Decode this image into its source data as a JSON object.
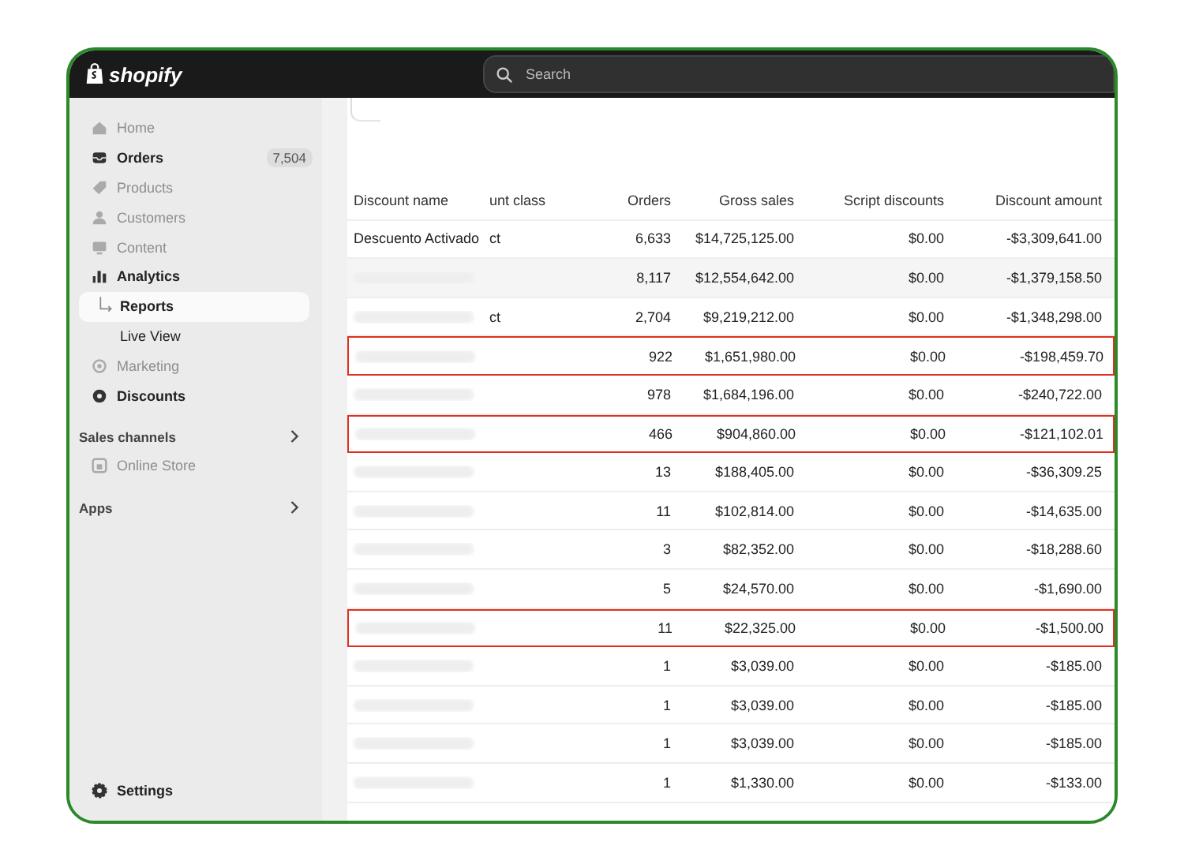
{
  "topbar": {
    "logo": "shopify",
    "search": {
      "placeholder": "Search"
    }
  },
  "sidebar": {
    "items": [
      {
        "label": "Home",
        "dimmed": true
      },
      {
        "label": "Orders",
        "dimmed": false,
        "badge": "7,504"
      },
      {
        "label": "Products",
        "dimmed": true
      },
      {
        "label": "Customers",
        "dimmed": true
      },
      {
        "label": "Content",
        "dimmed": true
      },
      {
        "label": "Analytics",
        "dimmed": false,
        "children": [
          {
            "label": "Reports",
            "selected": true
          },
          {
            "label": "Live View",
            "selected": false
          }
        ]
      },
      {
        "label": "Marketing",
        "dimmed": true
      },
      {
        "label": "Discounts",
        "dimmed": false
      }
    ],
    "sections": [
      {
        "title": "Sales channels",
        "items": [
          {
            "label": "Online Store",
            "dimmed": true
          }
        ]
      },
      {
        "title": "Apps"
      }
    ],
    "settings": "Settings"
  },
  "table": {
    "columns": [
      "Discount name",
      "unt class",
      "Orders",
      "Gross sales",
      "Script discounts",
      "Discount amount"
    ],
    "rows": [
      {
        "name": "Descuento Activado",
        "blurred": false,
        "class": "ct",
        "orders": "6,633",
        "gross": "$14,725,125.00",
        "script": "$0.00",
        "amount": "-$3,309,641.00",
        "highlighted": false
      },
      {
        "blurred": true,
        "class": "",
        "orders": "8,117",
        "gross": "$12,554,642.00",
        "script": "$0.00",
        "amount": "-$1,379,158.50",
        "highlighted": false
      },
      {
        "blurred": true,
        "class": "ct",
        "orders": "2,704",
        "gross": "$9,219,212.00",
        "script": "$0.00",
        "amount": "-$1,348,298.00",
        "highlighted": false
      },
      {
        "blurred": true,
        "class": "",
        "orders": "922",
        "gross": "$1,651,980.00",
        "script": "$0.00",
        "amount": "-$198,459.70",
        "highlighted": true
      },
      {
        "blurred": true,
        "class": "",
        "orders": "978",
        "gross": "$1,684,196.00",
        "script": "$0.00",
        "amount": "-$240,722.00",
        "highlighted": false
      },
      {
        "blurred": true,
        "class": "",
        "orders": "466",
        "gross": "$904,860.00",
        "script": "$0.00",
        "amount": "-$121,102.01",
        "highlighted": true
      },
      {
        "blurred": true,
        "class": "",
        "orders": "13",
        "gross": "$188,405.00",
        "script": "$0.00",
        "amount": "-$36,309.25",
        "highlighted": false
      },
      {
        "blurred": true,
        "class": "",
        "orders": "11",
        "gross": "$102,814.00",
        "script": "$0.00",
        "amount": "-$14,635.00",
        "highlighted": false
      },
      {
        "blurred": true,
        "class": "",
        "orders": "3",
        "gross": "$82,352.00",
        "script": "$0.00",
        "amount": "-$18,288.60",
        "highlighted": false
      },
      {
        "blurred": true,
        "class": "",
        "orders": "5",
        "gross": "$24,570.00",
        "script": "$0.00",
        "amount": "-$1,690.00",
        "highlighted": false
      },
      {
        "blurred": true,
        "class": "",
        "orders": "11",
        "gross": "$22,325.00",
        "script": "$0.00",
        "amount": "-$1,500.00",
        "highlighted": true
      },
      {
        "blurred": true,
        "class": "",
        "orders": "1",
        "gross": "$3,039.00",
        "script": "$0.00",
        "amount": "-$185.00",
        "highlighted": false
      },
      {
        "blurred": true,
        "class": "",
        "orders": "1",
        "gross": "$3,039.00",
        "script": "$0.00",
        "amount": "-$185.00",
        "highlighted": false
      },
      {
        "blurred": true,
        "class": "",
        "orders": "1",
        "gross": "$3,039.00",
        "script": "$0.00",
        "amount": "-$185.00",
        "highlighted": false
      },
      {
        "blurred": true,
        "class": "",
        "orders": "1",
        "gross": "$1,330.00",
        "script": "$0.00",
        "amount": "-$133.00",
        "highlighted": false
      }
    ]
  }
}
